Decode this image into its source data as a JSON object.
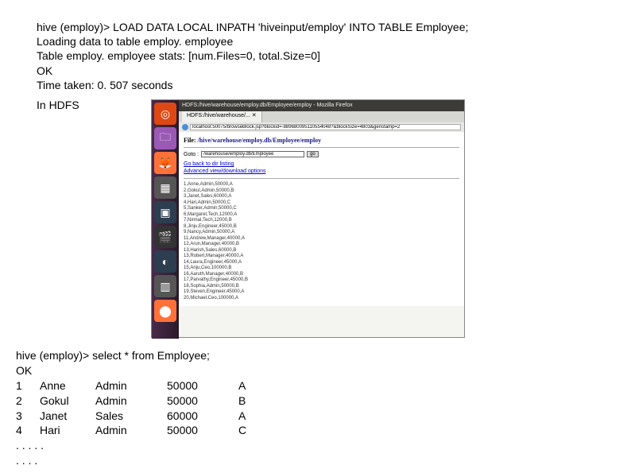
{
  "hive_output": {
    "line1": "hive (employ)> LOAD DATA LOCAL INPATH 'hiveinput/employ' INTO TABLE Employee;",
    "line2": "Loading data to table employ. employee",
    "line3": "Table employ. employee stats: [num.Files=0, total.Size=0]",
    "line4": "OK",
    "line5": "Time taken: 0. 507 seconds"
  },
  "in_hdfs": "In HDFS",
  "browser": {
    "title": "HDFS:/hive/warehouse/employ.db/Employee/employ - Mozilla Firefox",
    "tab": "HDFS:/hive/warehouse/... ✕",
    "url": "localhost:50075/browseBlock.jsp?blockid=-889680095110554048?&blockSize=4803&genstamp=2",
    "file_label": "File: ",
    "file_path": "/hive/warehouse/employ.db/Employee/employ",
    "goto_label": "Goto :",
    "goto_value": "/warehouse/employ.db/Employee",
    "goto_btn": "go",
    "link1": "Go back to dir listing",
    "link2": "Advanced view/download options",
    "data_rows": [
      "1,Anne,Admin,50000,A",
      "2,Gokul,Admin,50000,B",
      "3,Janet,Sales,60000,A",
      "4,Hari,Admin,50000,C",
      "5,Sanker,Admin,50000,C",
      "6,Margaret,Tech,12000,A",
      "7,Nirmal,Tech,12000,B",
      "8,Jinju,Engineer,45000,B",
      "9,Nancy,Admin,50000,A",
      "11,Andrew,Manager,40000,A",
      "12,Arun,Manager,40000,B",
      "13,Harish,Sales,60000,B",
      "13,Robert,Manager,40000,A",
      "14,Laura,Engineer,45000,A",
      "15,Anju,Ceo,100000,B",
      "16,Aaruth,Manager,40000,B",
      "17,Parvathy,Engineer,45000,B",
      "18,Sophia,Admin,50000,B",
      "19,Steven,Engineer,45000,A",
      "20,Michael,Ceo,100000,A"
    ]
  },
  "select": {
    "cmd": "hive (employ)> select * from Employee;",
    "ok": "OK",
    "rows": [
      {
        "id": "1",
        "name": "Anne",
        "role": "Admin",
        "sal": "50000",
        "grade": "A"
      },
      {
        "id": "2",
        "name": "Gokul",
        "role": "Admin",
        "sal": "50000",
        "grade": "B"
      },
      {
        "id": "3",
        "name": "Janet",
        "role": "Sales",
        "sal": "60000",
        "grade": "A"
      },
      {
        "id": "4",
        "name": "Hari",
        "role": "Admin",
        "sal": "50000",
        "grade": "C"
      }
    ],
    "ell1": ". . . . .",
    "ell2": ". . . ."
  }
}
